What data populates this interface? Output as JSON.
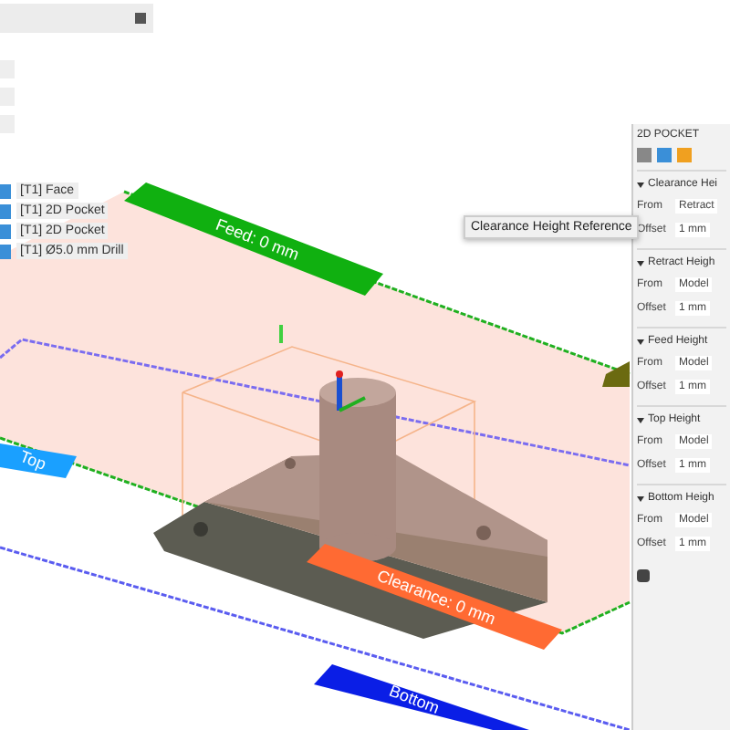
{
  "browser": {
    "items": [
      {
        "label": "[T1] Face"
      },
      {
        "label": "[T1] 2D Pocket"
      },
      {
        "label": "[T1] 2D Pocket"
      },
      {
        "label": "[T1] Ø5.0 mm Drill"
      }
    ]
  },
  "viewport": {
    "labels": [
      {
        "kind": "feed",
        "text": "Feed: 0 mm"
      },
      {
        "kind": "clearance",
        "text": "Clearance: 0 mm"
      },
      {
        "kind": "bottom",
        "text": "Bottom"
      },
      {
        "kind": "top",
        "text": "Top"
      }
    ],
    "tooltip": "Clearance Height Reference"
  },
  "panel": {
    "title": "2D POCKET",
    "sections": [
      {
        "title": "Clearance Hei",
        "from_label": "From",
        "from": "Retract",
        "offset_label": "Offset",
        "offset": "1 mm"
      },
      {
        "title": "Retract Heigh",
        "from_label": "From",
        "from": "Model",
        "offset_label": "Offset",
        "offset": "1 mm"
      },
      {
        "title": "Feed Height",
        "from_label": "From",
        "from": "Model",
        "offset_label": "Offset",
        "offset": "1 mm"
      },
      {
        "title": "Top Height",
        "from_label": "From",
        "from": "Model",
        "offset_label": "Offset",
        "offset": "1 mm"
      },
      {
        "title": "Bottom Heigh",
        "from_label": "From",
        "from": "Model",
        "offset_label": "Offset",
        "offset": "1 mm"
      }
    ]
  }
}
